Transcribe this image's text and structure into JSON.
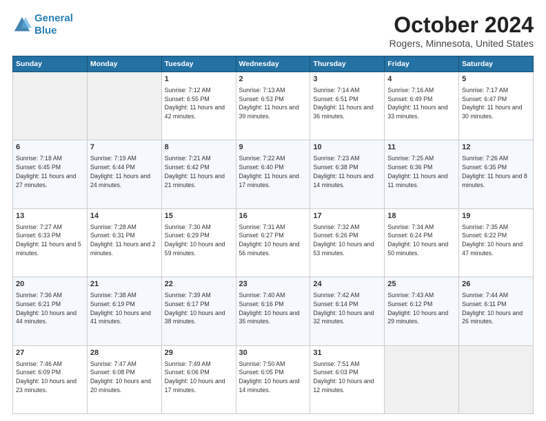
{
  "header": {
    "logo_line1": "General",
    "logo_line2": "Blue",
    "title": "October 2024",
    "subtitle": "Rogers, Minnesota, United States"
  },
  "days_of_week": [
    "Sunday",
    "Monday",
    "Tuesday",
    "Wednesday",
    "Thursday",
    "Friday",
    "Saturday"
  ],
  "weeks": [
    [
      {
        "day": "",
        "info": ""
      },
      {
        "day": "",
        "info": ""
      },
      {
        "day": "1",
        "info": "Sunrise: 7:12 AM\nSunset: 6:55 PM\nDaylight: 11 hours and 42 minutes."
      },
      {
        "day": "2",
        "info": "Sunrise: 7:13 AM\nSunset: 6:53 PM\nDaylight: 11 hours and 39 minutes."
      },
      {
        "day": "3",
        "info": "Sunrise: 7:14 AM\nSunset: 6:51 PM\nDaylight: 11 hours and 36 minutes."
      },
      {
        "day": "4",
        "info": "Sunrise: 7:16 AM\nSunset: 6:49 PM\nDaylight: 11 hours and 33 minutes."
      },
      {
        "day": "5",
        "info": "Sunrise: 7:17 AM\nSunset: 6:47 PM\nDaylight: 11 hours and 30 minutes."
      }
    ],
    [
      {
        "day": "6",
        "info": "Sunrise: 7:18 AM\nSunset: 6:45 PM\nDaylight: 11 hours and 27 minutes."
      },
      {
        "day": "7",
        "info": "Sunrise: 7:19 AM\nSunset: 6:44 PM\nDaylight: 11 hours and 24 minutes."
      },
      {
        "day": "8",
        "info": "Sunrise: 7:21 AM\nSunset: 6:42 PM\nDaylight: 11 hours and 21 minutes."
      },
      {
        "day": "9",
        "info": "Sunrise: 7:22 AM\nSunset: 6:40 PM\nDaylight: 11 hours and 17 minutes."
      },
      {
        "day": "10",
        "info": "Sunrise: 7:23 AM\nSunset: 6:38 PM\nDaylight: 11 hours and 14 minutes."
      },
      {
        "day": "11",
        "info": "Sunrise: 7:25 AM\nSunset: 6:36 PM\nDaylight: 11 hours and 11 minutes."
      },
      {
        "day": "12",
        "info": "Sunrise: 7:26 AM\nSunset: 6:35 PM\nDaylight: 11 hours and 8 minutes."
      }
    ],
    [
      {
        "day": "13",
        "info": "Sunrise: 7:27 AM\nSunset: 6:33 PM\nDaylight: 11 hours and 5 minutes."
      },
      {
        "day": "14",
        "info": "Sunrise: 7:28 AM\nSunset: 6:31 PM\nDaylight: 11 hours and 2 minutes."
      },
      {
        "day": "15",
        "info": "Sunrise: 7:30 AM\nSunset: 6:29 PM\nDaylight: 10 hours and 59 minutes."
      },
      {
        "day": "16",
        "info": "Sunrise: 7:31 AM\nSunset: 6:27 PM\nDaylight: 10 hours and 56 minutes."
      },
      {
        "day": "17",
        "info": "Sunrise: 7:32 AM\nSunset: 6:26 PM\nDaylight: 10 hours and 53 minutes."
      },
      {
        "day": "18",
        "info": "Sunrise: 7:34 AM\nSunset: 6:24 PM\nDaylight: 10 hours and 50 minutes."
      },
      {
        "day": "19",
        "info": "Sunrise: 7:35 AM\nSunset: 6:22 PM\nDaylight: 10 hours and 47 minutes."
      }
    ],
    [
      {
        "day": "20",
        "info": "Sunrise: 7:36 AM\nSunset: 6:21 PM\nDaylight: 10 hours and 44 minutes."
      },
      {
        "day": "21",
        "info": "Sunrise: 7:38 AM\nSunset: 6:19 PM\nDaylight: 10 hours and 41 minutes."
      },
      {
        "day": "22",
        "info": "Sunrise: 7:39 AM\nSunset: 6:17 PM\nDaylight: 10 hours and 38 minutes."
      },
      {
        "day": "23",
        "info": "Sunrise: 7:40 AM\nSunset: 6:16 PM\nDaylight: 10 hours and 35 minutes."
      },
      {
        "day": "24",
        "info": "Sunrise: 7:42 AM\nSunset: 6:14 PM\nDaylight: 10 hours and 32 minutes."
      },
      {
        "day": "25",
        "info": "Sunrise: 7:43 AM\nSunset: 6:12 PM\nDaylight: 10 hours and 29 minutes."
      },
      {
        "day": "26",
        "info": "Sunrise: 7:44 AM\nSunset: 6:11 PM\nDaylight: 10 hours and 26 minutes."
      }
    ],
    [
      {
        "day": "27",
        "info": "Sunrise: 7:46 AM\nSunset: 6:09 PM\nDaylight: 10 hours and 23 minutes."
      },
      {
        "day": "28",
        "info": "Sunrise: 7:47 AM\nSunset: 6:08 PM\nDaylight: 10 hours and 20 minutes."
      },
      {
        "day": "29",
        "info": "Sunrise: 7:49 AM\nSunset: 6:06 PM\nDaylight: 10 hours and 17 minutes."
      },
      {
        "day": "30",
        "info": "Sunrise: 7:50 AM\nSunset: 6:05 PM\nDaylight: 10 hours and 14 minutes."
      },
      {
        "day": "31",
        "info": "Sunrise: 7:51 AM\nSunset: 6:03 PM\nDaylight: 10 hours and 12 minutes."
      },
      {
        "day": "",
        "info": ""
      },
      {
        "day": "",
        "info": ""
      }
    ]
  ]
}
